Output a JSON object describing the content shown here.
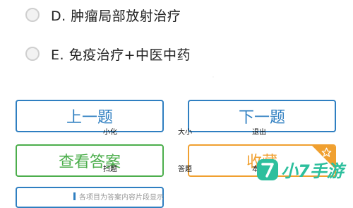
{
  "options": [
    {
      "letter": "D.",
      "text": "肿瘤局部放射治疗"
    },
    {
      "letter": "E.",
      "text": "免疫治疗+中医中药"
    }
  ],
  "buttons": {
    "prev": "上一题",
    "next": "下一题",
    "answer": "查看答案",
    "favorite": "收藏"
  },
  "overlay_labels": {
    "minimize": "小化",
    "size": "大小",
    "exit": "退出",
    "scan": "扫题",
    "answer_sheet": "答题",
    "notes": "本"
  },
  "watermark": {
    "text": "小7手游",
    "badge": "7"
  },
  "bottom_snippet": "各项目为答案内容片段显示"
}
